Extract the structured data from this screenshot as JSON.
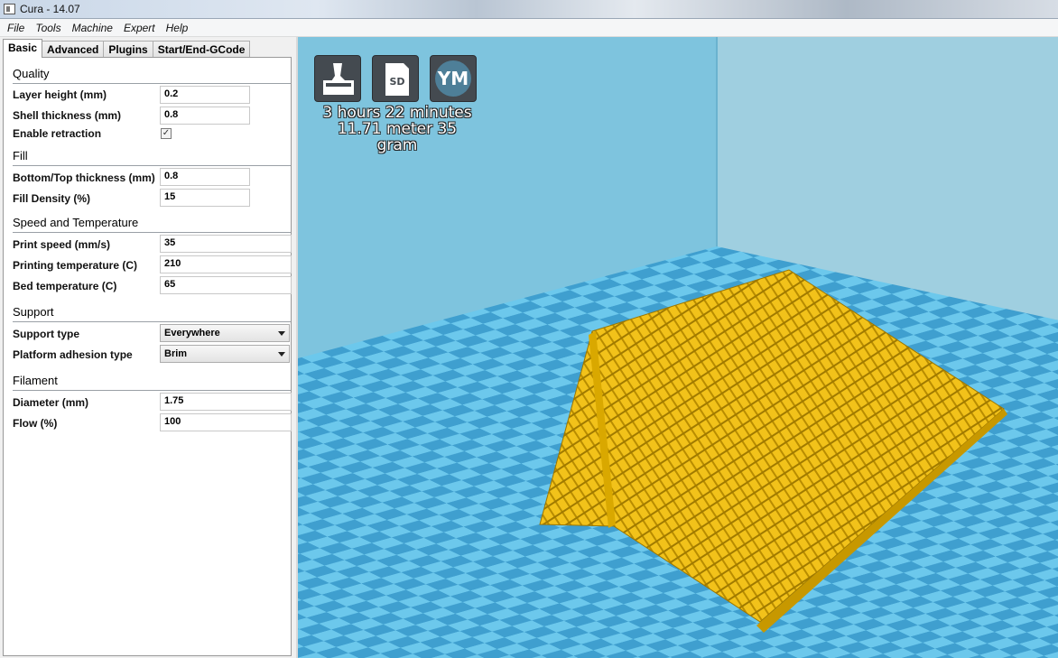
{
  "window": {
    "title": "Cura - 14.07"
  },
  "menu": [
    "File",
    "Tools",
    "Machine",
    "Expert",
    "Help"
  ],
  "tabs": [
    "Basic",
    "Advanced",
    "Plugins",
    "Start/End-GCode"
  ],
  "sections": {
    "quality": {
      "title": "Quality",
      "layer_height_label": "Layer height (mm)",
      "layer_height": "0.2",
      "shell_thickness_label": "Shell thickness (mm)",
      "shell_thickness": "0.8",
      "retraction_label": "Enable retraction",
      "retraction_checked": true
    },
    "fill": {
      "title": "Fill",
      "bottom_top_label": "Bottom/Top thickness (mm)",
      "bottom_top": "0.8",
      "density_label": "Fill Density (%)",
      "density": "15"
    },
    "speed": {
      "title": "Speed and Temperature",
      "print_speed_label": "Print speed (mm/s)",
      "print_speed": "35",
      "print_temp_label": "Printing temperature (C)",
      "print_temp": "210",
      "bed_temp_label": "Bed temperature (C)",
      "bed_temp": "65"
    },
    "support": {
      "title": "Support",
      "support_type_label": "Support type",
      "support_type": "Everywhere",
      "adhesion_label": "Platform adhesion type",
      "adhesion": "Brim"
    },
    "filament": {
      "title": "Filament",
      "diameter_label": "Diameter (mm)",
      "diameter": "1.75",
      "flow_label": "Flow (%)",
      "flow": "100"
    }
  },
  "viewport": {
    "buttons": {
      "load_icon": "load-model-icon",
      "sd_icon": "sd-card-icon",
      "sd_text": "SD",
      "ym_text": "YM"
    },
    "print_time": "3 hours 22 minutes",
    "print_amount": "11.71 meter 35 gram",
    "colors": {
      "background": "#5db9d9",
      "model": "#f5c518",
      "grid_dark": "#3f9fcf",
      "grid_light": "#6cc8ec"
    }
  }
}
